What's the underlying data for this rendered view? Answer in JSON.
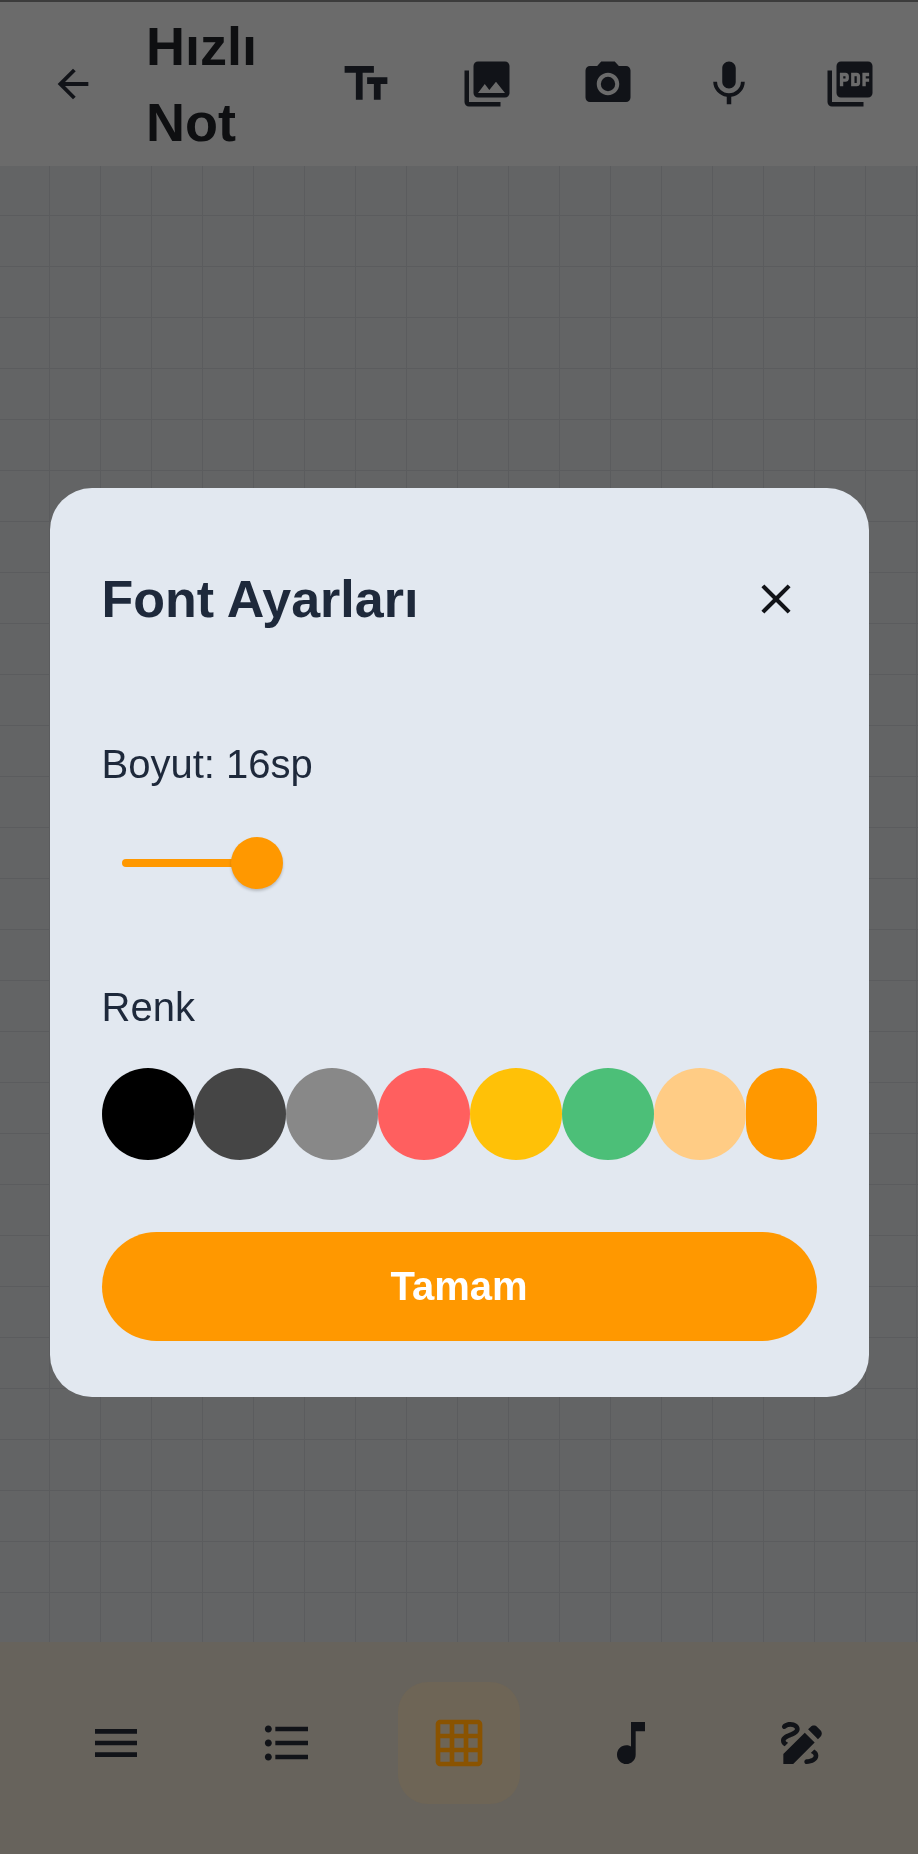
{
  "app_bar": {
    "title": "Hızlı Not",
    "actions": [
      {
        "kind": "text_size"
      },
      {
        "kind": "gallery"
      },
      {
        "kind": "camera"
      },
      {
        "kind": "mic"
      },
      {
        "kind": "pdf"
      }
    ]
  },
  "dialog": {
    "title": "Font Ayarları",
    "size_label": "Boyut: 16sp",
    "size_slider": {
      "level": 0.2
    },
    "color_label": "Renk",
    "swatches": [
      {
        "color": "#000000"
      },
      {
        "color": "#454545"
      },
      {
        "color": "#888888"
      },
      {
        "color": "#ff5f5f"
      },
      {
        "color": "#ffc107"
      },
      {
        "color": "#4cbf78"
      },
      {
        "color": "#ffcc85"
      },
      {
        "color": "#ff9800"
      }
    ],
    "confirm": "Tamam"
  },
  "bottom_nav": [
    {
      "kind": "text",
      "selected": false
    },
    {
      "kind": "list",
      "selected": false
    },
    {
      "kind": "grid",
      "selected": true
    },
    {
      "kind": "music",
      "selected": false
    },
    {
      "kind": "draw",
      "selected": false
    }
  ]
}
